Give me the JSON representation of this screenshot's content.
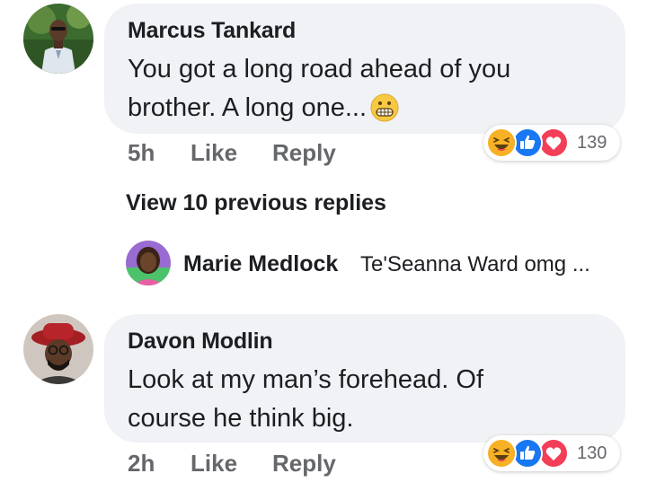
{
  "comments": [
    {
      "author": "Marcus Tankard",
      "text_line1": "You got a long road ahead of you",
      "text_line2": "brother. A long one...",
      "inline_emoji": "grimacing-face-emoji",
      "time": "5h",
      "like_label": "Like",
      "reply_label": "Reply",
      "reactions": [
        "haha",
        "like",
        "love"
      ],
      "reaction_count": "139"
    },
    {
      "author": "Davon Modlin",
      "text_line1": "Look at my man’s forehead. Of",
      "text_line2": "course he think big.",
      "time": "2h",
      "like_label": "Like",
      "reply_label": "Reply",
      "reactions": [
        "haha",
        "like",
        "love"
      ],
      "reaction_count": "130"
    }
  ],
  "view_previous_replies": "View 10 previous replies",
  "reply_preview": {
    "author": "Marie Medlock",
    "text": "Te'Seanna Ward omg ..."
  },
  "colors": {
    "bubble_bg": "#f0f2f5",
    "secondary_text": "#65676b",
    "primary_text": "#1c1e21",
    "like_blue": "#1877f2",
    "love_red": "#f33e58",
    "haha_yellow": "#f7b125"
  }
}
